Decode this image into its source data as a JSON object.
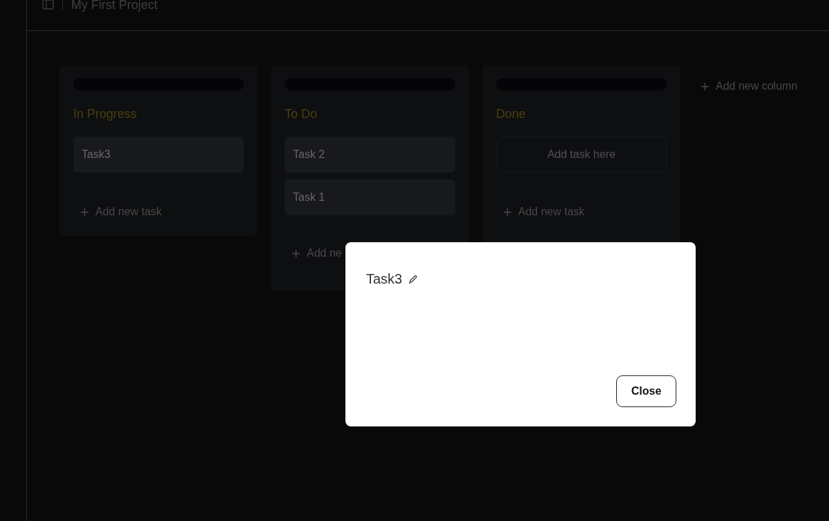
{
  "header": {
    "title": "My First Project"
  },
  "columns": [
    {
      "title": "In Progress",
      "tasks": [
        "Task3"
      ],
      "add_task": "Add new task"
    },
    {
      "title": "To Do",
      "tasks": [
        "Task 2",
        "Task 1"
      ],
      "add_task": "Add ne"
    },
    {
      "title": "Done",
      "drop_placeholder": "Add task here",
      "add_task": "Add new task"
    }
  ],
  "add_column": "Add new column",
  "modal": {
    "title": "Task3",
    "button": "Close"
  }
}
